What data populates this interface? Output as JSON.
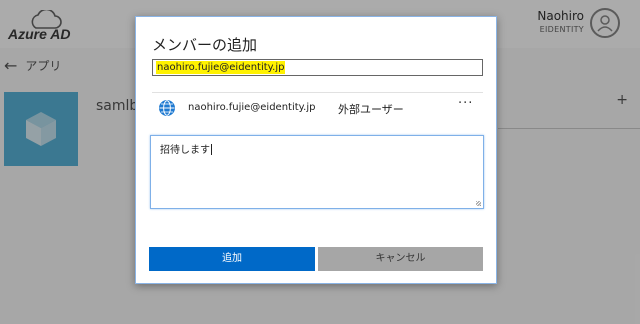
{
  "background": {
    "logo_text": "Azure AD",
    "user_name": "Naohiro",
    "user_org": "EIDENTITY",
    "back_label": "アプリ",
    "app_name": "samlb"
  },
  "dialog": {
    "title": "メンバーの追加",
    "search_value": "naohiro.fujie@eidentity.jp",
    "result": {
      "email": "naohiro.fujie@eidentity.jp",
      "type": "外部ユーザー",
      "more": "···"
    },
    "message": "招待します",
    "add_label": "追加",
    "cancel_label": "キャンセル"
  },
  "colors": {
    "primary_button": "#0069c8",
    "secondary_button": "#a6a6a6",
    "search_highlight": "#fff200",
    "app_tile": "#59b4d9",
    "globe": "#1f7ad1"
  },
  "icons": [
    "cloud-icon",
    "back-arrow-icon",
    "avatar-icon",
    "app-cube-icon",
    "globe-icon",
    "more-icon",
    "resize-grip-icon"
  ]
}
